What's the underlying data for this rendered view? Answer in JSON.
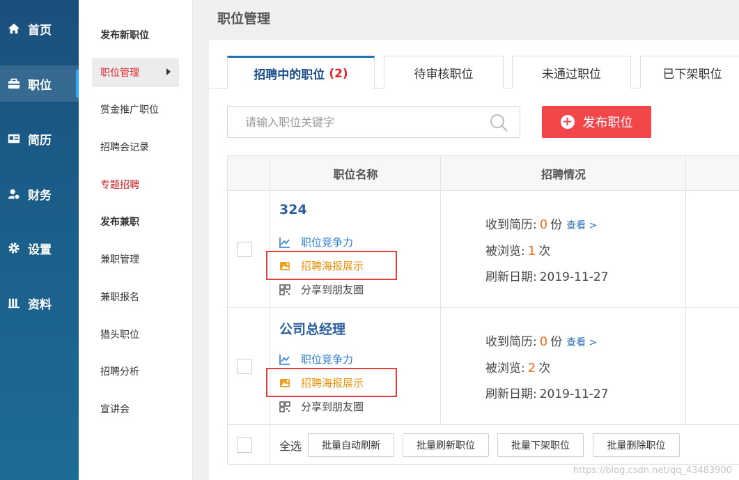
{
  "nav": {
    "items": [
      {
        "label": "首页",
        "icon": "home-icon"
      },
      {
        "label": "职位",
        "icon": "briefcase-icon"
      },
      {
        "label": "简历",
        "icon": "id-card-icon"
      },
      {
        "label": "财务",
        "icon": "finance-icon"
      },
      {
        "label": "设置",
        "icon": "gear-icon"
      },
      {
        "label": "资料",
        "icon": "books-icon"
      }
    ]
  },
  "submenu": {
    "items": [
      {
        "label": "发布新职位"
      },
      {
        "label": "职位管理"
      },
      {
        "label": "赏金推广职位"
      },
      {
        "label": "招聘会记录"
      },
      {
        "label": "专题招聘"
      },
      {
        "label": "发布兼职"
      },
      {
        "label": "兼职管理"
      },
      {
        "label": "兼职报名"
      },
      {
        "label": "猎头职位"
      },
      {
        "label": "招聘分析"
      },
      {
        "label": "宣讲会"
      }
    ]
  },
  "page": {
    "title": "职位管理"
  },
  "tabs": [
    {
      "label": "招聘中的职位",
      "count": "(2)"
    },
    {
      "label": "待审核职位"
    },
    {
      "label": "未通过职位"
    },
    {
      "label": "已下架职位"
    }
  ],
  "search": {
    "placeholder": "请输入职位关键字"
  },
  "publish_button": {
    "label": "发布职位"
  },
  "table": {
    "headers": [
      "职位名称",
      "招聘情况"
    ],
    "rows": [
      {
        "title": "324",
        "links": [
          "职位竞争力",
          "招聘海报展示",
          "分享到朋友圈"
        ],
        "received_label": "收到简历:",
        "received_count": "0",
        "received_unit": "份",
        "view_label": "查看 >",
        "views_label": "被浏览:",
        "views_count": "1",
        "views_unit": "次",
        "refresh_label": "刷新日期:",
        "refresh_date": "2019-11-27"
      },
      {
        "title": "公司总经理",
        "links": [
          "职位竞争力",
          "招聘海报展示",
          "分享到朋友圈"
        ],
        "received_label": "收到简历:",
        "received_count": "0",
        "received_unit": "份",
        "view_label": "查看 >",
        "views_label": "被浏览:",
        "views_count": "2",
        "views_unit": "次",
        "refresh_label": "刷新日期:",
        "refresh_date": "2019-11-27"
      }
    ],
    "footer": {
      "select_all": "全选",
      "buttons": [
        "批量自动刷新",
        "批量刷新职位",
        "批量下架职位",
        "批量删除职位"
      ]
    }
  },
  "watermark": "https://blog.csdn.net/qq_43483900",
  "colors": {
    "accent_red": "#f2464b",
    "link_blue": "#2a7bd0",
    "poster_orange": "#e8930c",
    "tab_blue": "#1f72b5"
  }
}
